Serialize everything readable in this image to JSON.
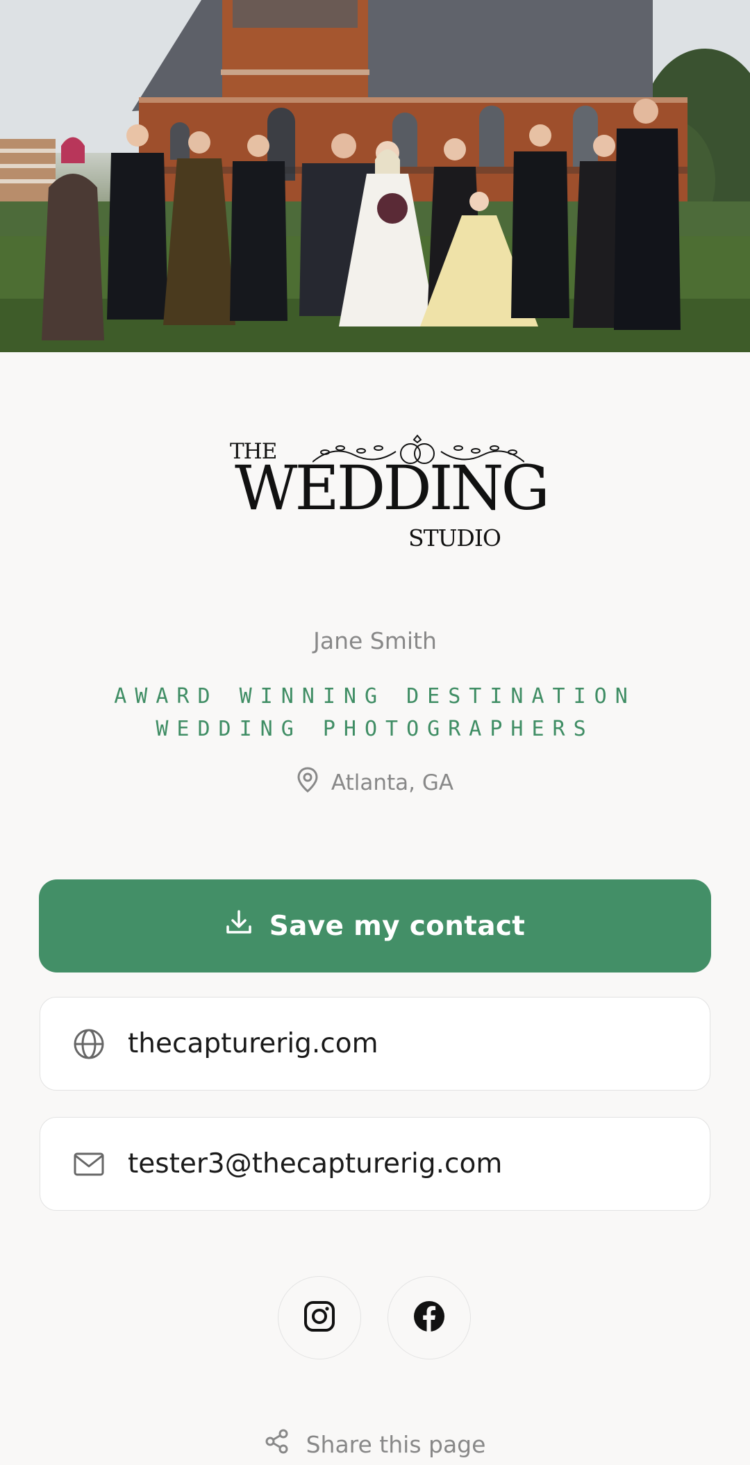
{
  "hero": {
    "alt": "Wedding party standing in front of a brick chapel"
  },
  "logo": {
    "line1": "THE",
    "line2": "WEDDING",
    "line3": "STUDIO"
  },
  "profile": {
    "name": "Jane Smith",
    "tagline": "AWARD WINNING DESTINATION WEDDING PHOTOGRAPHERS",
    "location": "Atlanta, GA",
    "location_icon": "map-pin-icon"
  },
  "actions": {
    "save_label": "Save my contact",
    "save_icon": "download-icon"
  },
  "links": [
    {
      "icon": "globe-icon",
      "text": "thecapturerig.com"
    },
    {
      "icon": "mail-icon",
      "text": "tester3@thecapturerig.com"
    }
  ],
  "social": [
    {
      "icon": "instagram-icon",
      "name": "Instagram"
    },
    {
      "icon": "facebook-icon",
      "name": "Facebook"
    }
  ],
  "footer": {
    "share_label": "Share this page",
    "share_icon": "share-icon"
  },
  "colors": {
    "accent": "#438f67",
    "tagline": "#3f8d64",
    "muted_text": "#888888",
    "background": "#f9f8f7"
  }
}
